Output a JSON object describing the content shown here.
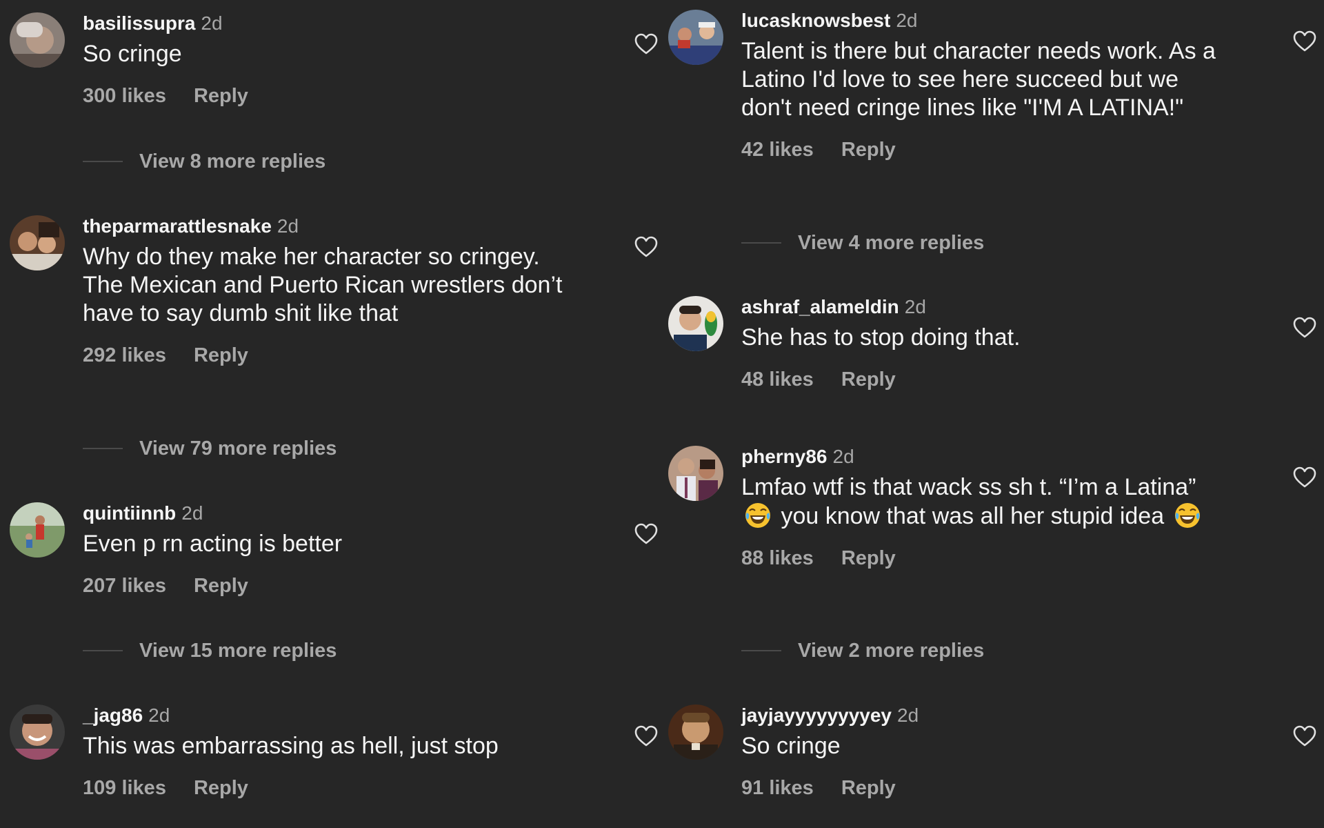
{
  "colors": {
    "background": "#262626",
    "username": "#f5f5f5",
    "text": "#f5f5f5",
    "muted": "#a8a8a8",
    "divider": "#4a4a4a"
  },
  "reply_label": "Reply",
  "comments_left": [
    {
      "username": "basilissupra",
      "time": "2d",
      "text": "So cringe",
      "likes": "300 likes",
      "view_more": "View 8 more replies"
    },
    {
      "username": "theparmarattlesnake",
      "time": "2d",
      "text": "Why do they make her character so cringey. The Mexican and Puerto Rican wrestlers don’t have to say dumb shit like that",
      "likes": "292 likes",
      "view_more": "View 79 more replies"
    },
    {
      "username": "quintiinnb",
      "time": "2d",
      "text": "Even p rn acting is better",
      "likes": "207 likes",
      "view_more": "View 15 more replies"
    },
    {
      "username": "_jag86",
      "time": "2d",
      "text": "This was embarrassing as hell, just stop",
      "likes": "109 likes"
    }
  ],
  "comments_right": [
    {
      "username": "lucasknowsbest",
      "time": "2d",
      "text": "Talent is there but character needs work. As a Latino I'd love to see here succeed but we don't need cringe lines like \"I'M A LATINA!\"",
      "likes": "42 likes",
      "view_more": "View 4 more replies"
    },
    {
      "username": "ashraf_alameldin",
      "time": "2d",
      "text": "She has to stop doing that.",
      "likes": "48 likes"
    },
    {
      "username": "pherny86",
      "time": "2d",
      "text_part1": "Lmfao wtf is that wack  ss sh t. “I’m a Latina”",
      "text_part2": "you know that was all her stupid idea",
      "emoji_name": "face-with-tears-of-joy",
      "likes": "88 likes",
      "view_more": "View 2 more replies"
    },
    {
      "username": "jayjayyyyyyyyey",
      "time": "2d",
      "text": "So cringe",
      "likes": "91 likes"
    }
  ],
  "icons": {
    "like": "heart-outline-icon"
  }
}
